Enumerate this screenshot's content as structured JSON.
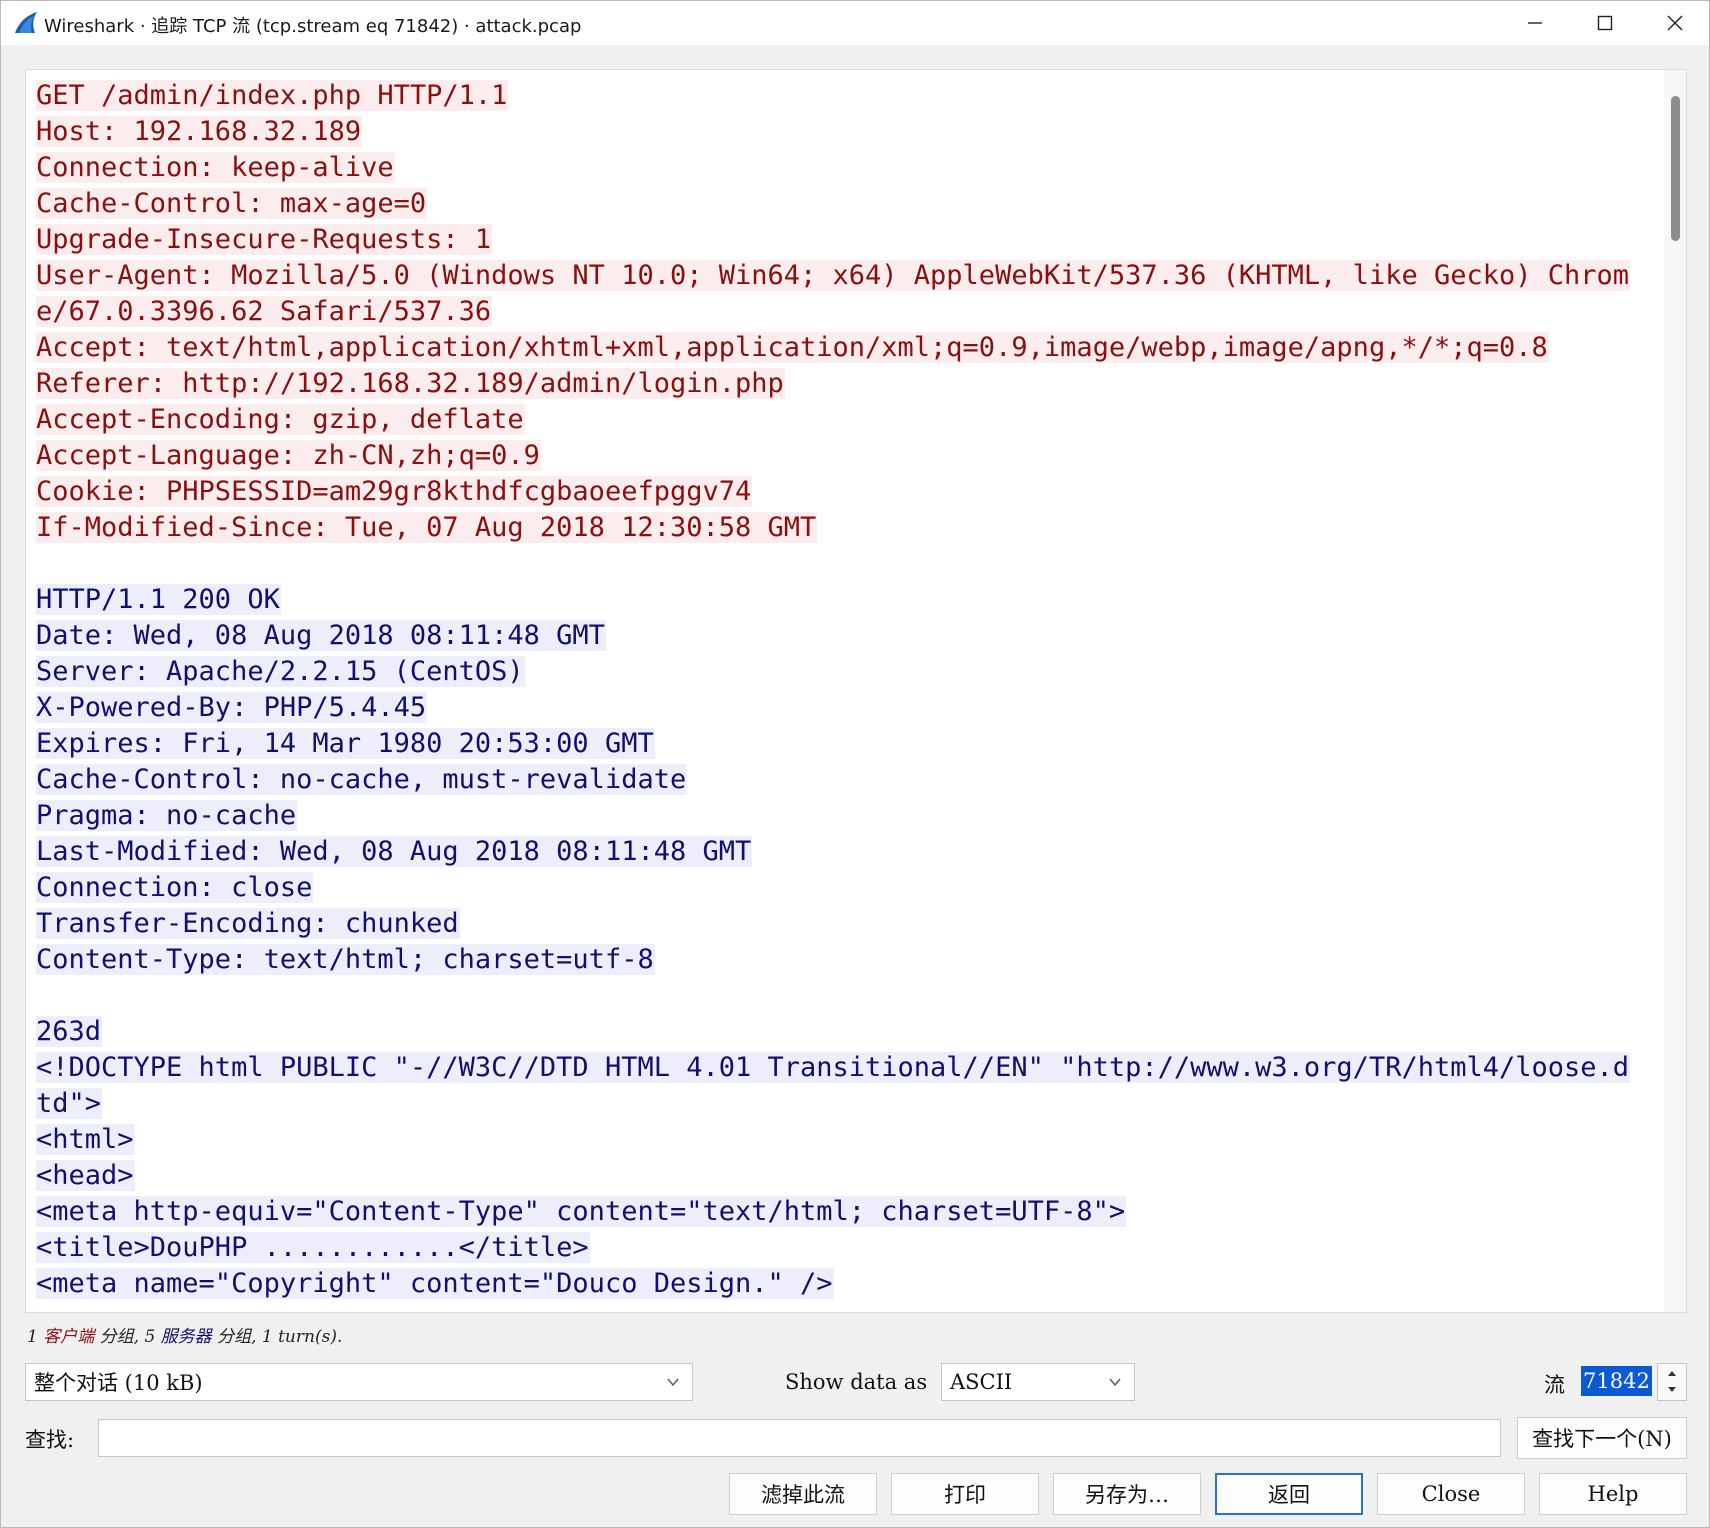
{
  "window": {
    "title": "Wireshark · 追踪 TCP 流 (tcp.stream eq 71842) · attack.pcap",
    "controls": [
      "minimize",
      "maximize",
      "close"
    ]
  },
  "stream": {
    "lines": [
      {
        "type": "client",
        "text": "GET /admin/index.php HTTP/1.1"
      },
      {
        "type": "client",
        "text": "Host: 192.168.32.189"
      },
      {
        "type": "client",
        "text": "Connection: keep-alive"
      },
      {
        "type": "client",
        "text": "Cache-Control: max-age=0"
      },
      {
        "type": "client",
        "text": "Upgrade-Insecure-Requests: 1"
      },
      {
        "type": "client",
        "text": "User-Agent: Mozilla/5.0 (Windows NT 10.0; Win64; x64) AppleWebKit/537.36 (KHTML, like Gecko) Chrom"
      },
      {
        "type": "client",
        "text": "e/67.0.3396.62 Safari/537.36"
      },
      {
        "type": "client",
        "text": "Accept: text/html,application/xhtml+xml,application/xml;q=0.9,image/webp,image/apng,*/*;q=0.8"
      },
      {
        "type": "client",
        "text": "Referer: http://192.168.32.189/admin/login.php"
      },
      {
        "type": "client",
        "text": "Accept-Encoding: gzip, deflate"
      },
      {
        "type": "client",
        "text": "Accept-Language: zh-CN,zh;q=0.9"
      },
      {
        "type": "client",
        "text": "Cookie: PHPSESSID=am29gr8kthdfcgbaoeefpggv74"
      },
      {
        "type": "client",
        "text": "If-Modified-Since: Tue, 07 Aug 2018 12:30:58 GMT"
      },
      {
        "type": "blank",
        "text": ""
      },
      {
        "type": "server",
        "text": "HTTP/1.1 200 OK"
      },
      {
        "type": "server",
        "text": "Date: Wed, 08 Aug 2018 08:11:48 GMT"
      },
      {
        "type": "server",
        "text": "Server: Apache/2.2.15 (CentOS)"
      },
      {
        "type": "server",
        "text": "X-Powered-By: PHP/5.4.45"
      },
      {
        "type": "server",
        "text": "Expires: Fri, 14 Mar 1980 20:53:00 GMT"
      },
      {
        "type": "server",
        "text": "Cache-Control: no-cache, must-revalidate"
      },
      {
        "type": "server",
        "text": "Pragma: no-cache"
      },
      {
        "type": "server",
        "text": "Last-Modified: Wed, 08 Aug 2018 08:11:48 GMT"
      },
      {
        "type": "server",
        "text": "Connection: close"
      },
      {
        "type": "server",
        "text": "Transfer-Encoding: chunked"
      },
      {
        "type": "server",
        "text": "Content-Type: text/html; charset=utf-8"
      },
      {
        "type": "blank",
        "text": ""
      },
      {
        "type": "server",
        "text": "263d"
      },
      {
        "type": "server",
        "text": "<!DOCTYPE html PUBLIC \"-//W3C//DTD HTML 4.01 Transitional//EN\" \"http://www.w3.org/TR/html4/loose.d"
      },
      {
        "type": "server",
        "text": "td\">"
      },
      {
        "type": "server",
        "text": "<html>"
      },
      {
        "type": "server",
        "text": "<head>"
      },
      {
        "type": "server",
        "text": "<meta http-equiv=\"Content-Type\" content=\"text/html; charset=UTF-8\">"
      },
      {
        "type": "server",
        "text": "<title>DouPHP ............</title>"
      },
      {
        "type": "server",
        "text": "<meta name=\"Copyright\" content=\"Douco Design.\" />"
      }
    ]
  },
  "stats": {
    "part1": "1 ",
    "client_label": "客户端",
    "part2": " 分组, 5 ",
    "server_label": "服务器",
    "part3": " 分组, 1 turn(s)."
  },
  "controls": {
    "conversation_select": "整个对话 (10 kB)",
    "show_data_as_label": "Show data as",
    "show_data_as_value": "ASCII",
    "stream_label": "流",
    "stream_value": "71842",
    "find_label": "查找:",
    "find_value": "",
    "find_next_button": "查找下一个(N)"
  },
  "buttons": {
    "filter_out": "滤掉此流",
    "print": "打印",
    "save_as": "另存为…",
    "back": "返回",
    "close": "Close",
    "help": "Help"
  },
  "colors": {
    "client_text": "#8b0f0f",
    "client_bg": "#fbeded",
    "server_text": "#101070",
    "server_bg": "#ededfb",
    "accent": "#0a5bd3"
  }
}
